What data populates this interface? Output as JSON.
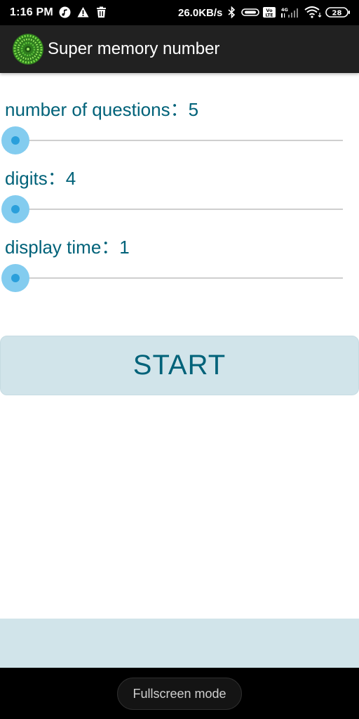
{
  "status_bar": {
    "time": "1:16 PM",
    "network_speed": "26.0KB/s",
    "network_type": "4G",
    "volte_label": "Vo LTE",
    "battery_level": "28",
    "icons": [
      "music-icon",
      "warning-icon",
      "trash-icon",
      "bluetooth-icon",
      "vibrate-icon",
      "volte-icon",
      "signal-icon",
      "wifi-icon",
      "battery-icon"
    ]
  },
  "app_bar": {
    "title": "Super memory number",
    "logo_icon": "green-circle-logo-icon"
  },
  "settings": [
    {
      "label": "number of questions：5",
      "slider_fraction": 0.0
    },
    {
      "label": "digits：4",
      "slider_fraction": 0.0
    },
    {
      "label": "display time：1",
      "slider_fraction": 0.0
    }
  ],
  "start_button": {
    "label": "START"
  },
  "navigation": {
    "fullscreen_label": "Fullscreen mode"
  },
  "colors": {
    "label_text": "#006279",
    "slider_thumb": "#2a9fdb",
    "slider_halo": "#83ccef",
    "button_bg": "#d1e4ea",
    "app_bar_bg": "#212121"
  }
}
